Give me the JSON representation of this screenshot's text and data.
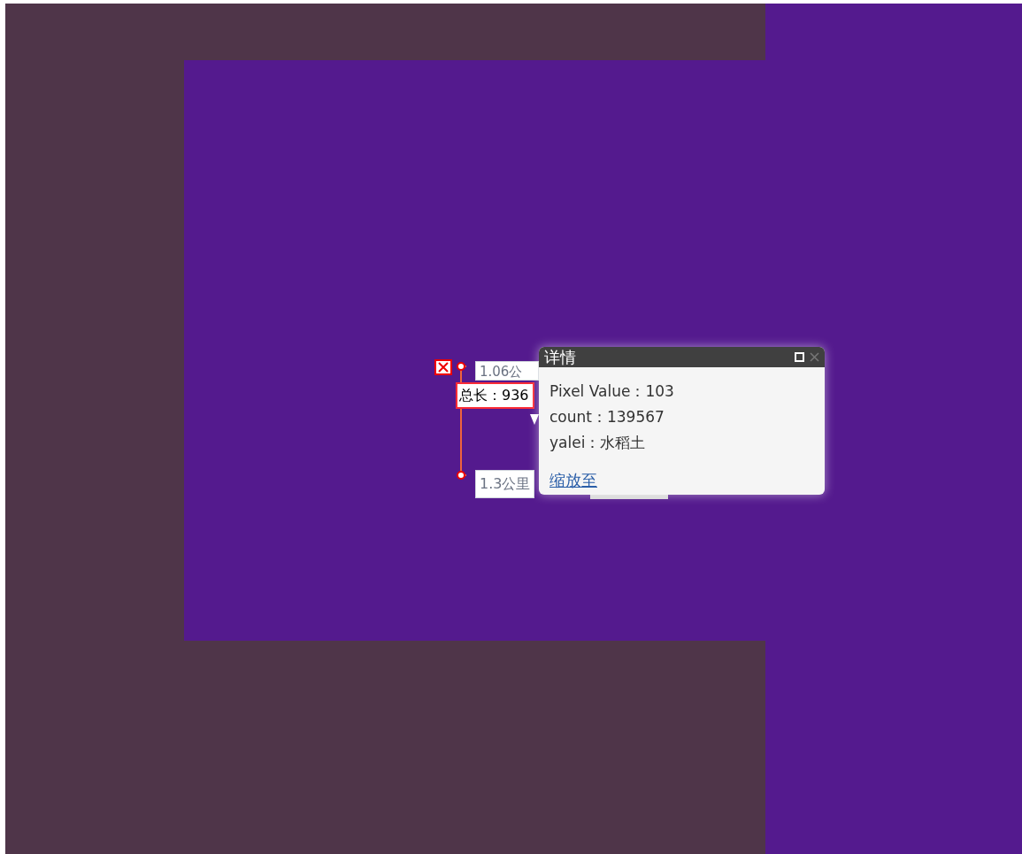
{
  "measure": {
    "segment_labels": [
      "1.06公",
      "1.3公里"
    ],
    "total_label": "总长：936"
  },
  "popup": {
    "title": "详情",
    "fields": [
      {
        "text": "Pixel Value：103"
      },
      {
        "text": "count：139567"
      },
      {
        "text": "yalei：水稻土"
      }
    ],
    "link": "缩放至"
  }
}
